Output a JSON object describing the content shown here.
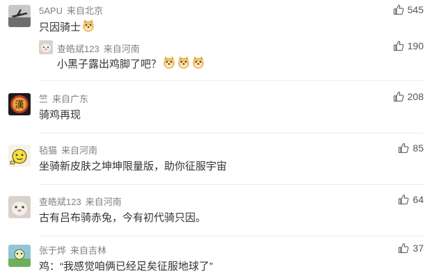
{
  "comments": [
    {
      "user": "5APU",
      "location": "来自北京",
      "text": "只因骑士",
      "emoji_count": 1,
      "likes": "545",
      "reply": {
        "user": "查皓斌123",
        "location": "来自河南",
        "text": "小黑子露出鸡脚了吧？",
        "emoji_count": 3,
        "likes": "190"
      }
    },
    {
      "user": "竺",
      "location": "来自广东",
      "text": "骑鸡再现",
      "emoji_count": 0,
      "likes": "208",
      "avatar_char": "漢"
    },
    {
      "user": "毡猫",
      "location": "来自河南",
      "text": "坐骑新皮肤之坤坤限量版，助你征服宇宙",
      "emoji_count": 0,
      "likes": "85"
    },
    {
      "user": "查皓斌123",
      "location": "来自河南",
      "text": "古有吕布骑赤兔，今有初代骑只因。",
      "emoji_count": 0,
      "likes": "64"
    },
    {
      "user": "张于烨",
      "location": "来自吉林",
      "text": "鸡：“我感觉咱俩已经足矣征服地球了”",
      "emoji_count": 0,
      "likes": "37"
    }
  ],
  "colors": {
    "meta": "#808080",
    "text": "#333333",
    "like_icon": "#666666",
    "separator": "#ececec"
  },
  "icons": {
    "like": "thumbs-up-icon",
    "emoji": "doge-emoji-icon"
  }
}
